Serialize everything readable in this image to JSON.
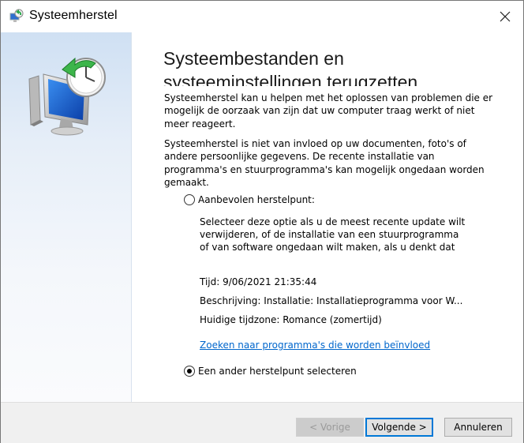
{
  "window": {
    "title": "Systeemherstel",
    "close_icon": "close-icon",
    "app_icon": "system-restore-icon"
  },
  "main": {
    "heading_line1": "Systeembestanden en",
    "heading_line2": "systeeminstellingen terugzetten",
    "paragraph1": "Systeemherstel kan u helpen met het oplossen van problemen die er mogelijk de oorzaak van zijn dat uw computer traag werkt of niet meer reageert.",
    "paragraph2": "Systeemherstel is niet van invloed op uw documenten, foto's of andere persoonlijke gegevens. De recente installatie van programma's en stuurprogramma's kan mogelijk ongedaan worden gemaakt.",
    "recommended": {
      "label": "Aanbevolen herstelpunt:",
      "selected": false,
      "description": "Selecteer deze optie als u de meest recente update wilt verwijderen, of de installatie van een stuurprogramma of van software ongedaan wilt maken, als u denkt dat",
      "time": "Tijd: 9/06/2021 21:35:44",
      "description_line": "Beschrijving: Installatie: Installatieprogramma voor W...",
      "timezone": "Huidige tijdzone: Romance (zomertijd)",
      "link": "Zoeken naar programma's die worden beïnvloed"
    },
    "other": {
      "label": "Een ander herstelpunt selecteren",
      "selected": true
    }
  },
  "footer": {
    "prev_label": "< Vorige",
    "next_label": "Volgende >",
    "cancel_label": "Annuleren"
  },
  "colors": {
    "accent": "#0078d7",
    "link": "#0066cc",
    "panel_top": "#cfe0f3"
  }
}
